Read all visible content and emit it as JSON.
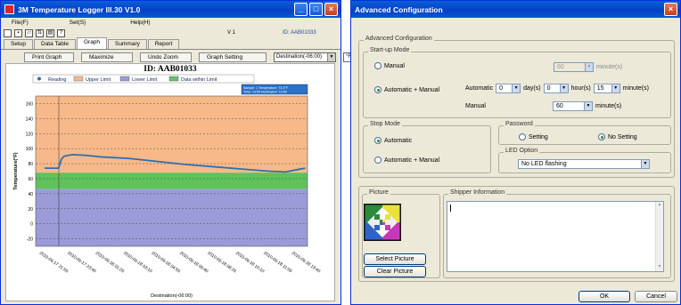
{
  "logger": {
    "title": "3M Temperature Logger Ill.30 V1.0",
    "menu": [
      "File(F)",
      "Set(S)",
      "Help(H)"
    ],
    "version": "V 1",
    "id_label": "ID: AAB01033",
    "tabs": [
      "Setup",
      "Data Table",
      "Graph",
      "Summary",
      "Report"
    ],
    "active_tab": "Graph",
    "buttons": {
      "print": "Print Graph",
      "maximize": "Maximize",
      "undo_zoom": "Undo Zoom",
      "graph_setting": "Graph Setting"
    },
    "timezone_select": "Destination(-06:00)",
    "unit_select": "°F"
  },
  "chart_data": {
    "type": "line",
    "title": "ID: AAB01033",
    "legend": [
      "Reading",
      "Upper Limit",
      "Lower Limit",
      "Data within Limit"
    ],
    "legend_colors": [
      "#2e6fb0",
      "#f5b98c",
      "#9a9bd8",
      "#63c16a"
    ],
    "xlabel": "Destination(-06:00)",
    "ylabel": "Temperature(°F)",
    "ylim": [
      -30,
      170
    ],
    "yticks": [
      160,
      140,
      120,
      100,
      80,
      60,
      40,
      20,
      0,
      -20
    ],
    "upper_limit": 68,
    "lower_limit": 46,
    "x_tick_labels": [
      "2010-06-17 21:55",
      "2010-06-17 23:40",
      "2010-06-18 01:25",
      "2010-06-18 03:10",
      "2010-06-18 04:55",
      "2010-06-18 06:40",
      "2010-06-18 08:25",
      "2010-06-18 10:10",
      "2010-06-18 11:55",
      "2010-06-18 13:40"
    ],
    "series": [
      {
        "name": "Reading",
        "color": "#2e6fb0",
        "x": [
          0,
          0.3,
          0.5,
          0.6,
          0.7,
          1.0,
          1.5,
          2.0,
          3.0,
          4.0,
          5.0,
          6.0,
          7.0,
          8.0,
          8.6,
          9.0,
          9.3
        ],
        "y": [
          74,
          74,
          74,
          86,
          90,
          92,
          91,
          89,
          87,
          83,
          79,
          76,
          73,
          70,
          69,
          72,
          74
        ]
      }
    ],
    "info_box": [
      "Sample: 1",
      "Temperature: 73.4°F",
      "Time: 13:55",
      "Destination: 13:55"
    ],
    "grid": true
  },
  "config": {
    "title": "Advanced Configuration",
    "group_title": "Advanced Configuration",
    "startup_mode": {
      "label": "Start-up Mode",
      "manual_label": "Manual",
      "manual_value": "60",
      "auto_manual_label": "Automatic + Manual",
      "automatic_label": "Automatic",
      "day_value": "0",
      "day_unit": "day(s)",
      "hour_value": "0",
      "hour_unit": "hour(s)",
      "minute_value": "15",
      "minute_unit": "minute(s)",
      "manual2_label": "Manual",
      "manual2_value": "60",
      "minute2_unit": "minute(s)",
      "minute_dis_unit": "minute(s)"
    },
    "stop_mode": {
      "label": "Stop Mode",
      "automatic": "Automatic",
      "auto_manual": "Automatic + Manual"
    },
    "password": {
      "label": "Password",
      "setting": "Setting",
      "no_setting": "No Setting"
    },
    "led": {
      "label": "LED Option",
      "value": "No LED flashing"
    },
    "picture": {
      "label": "Picture",
      "select": "Select Picture",
      "clear": "Clear Picture"
    },
    "shipper": {
      "label": "Shipper Information"
    },
    "ok": "OK",
    "cancel": "Cancel"
  }
}
